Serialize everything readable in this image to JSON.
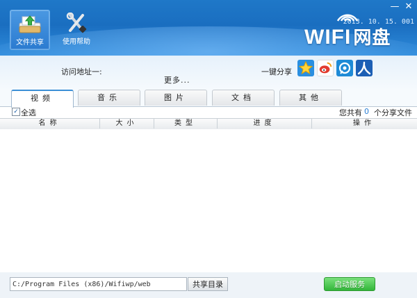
{
  "header": {
    "nav": [
      {
        "label": "文件共享",
        "icon": "folder-upload-icon",
        "active": true
      },
      {
        "label": "使用帮助",
        "icon": "tools-icon",
        "active": false
      }
    ],
    "version": "2013. 10. 15. 001",
    "brand_latin": "WIFI",
    "brand_cn": "网盘",
    "window_controls": [
      "—",
      "✕"
    ]
  },
  "info": {
    "access_label": "访问地址一:",
    "more_label": "更多...",
    "share_label": "一键分享",
    "share_icons": [
      {
        "name": "qzone-icon",
        "color": "#2a8fe0"
      },
      {
        "name": "weibo-icon",
        "color": "#e23b2e"
      },
      {
        "name": "tencent-weibo-icon",
        "color": "#1e8ad6"
      },
      {
        "name": "renren-icon",
        "color": "#1c5fb5"
      }
    ]
  },
  "tabs": [
    {
      "label": "视频",
      "active": true
    },
    {
      "label": "音乐",
      "active": false
    },
    {
      "label": "图片",
      "active": false
    },
    {
      "label": "文档",
      "active": false
    },
    {
      "label": "其他",
      "active": false
    }
  ],
  "toolbar": {
    "select_all": "全选",
    "count_prefix": "您共有",
    "count": "0",
    "count_suffix": "个分享文件"
  },
  "table": {
    "columns": [
      "名称",
      "大小",
      "类型",
      "进度",
      "操作"
    ]
  },
  "footer": {
    "path": "C:/Program Files (x86)/Wifiwp/web",
    "share_dir_label": "共享目录",
    "start_label": "启动服务"
  },
  "colors": {
    "header_blue": "#1f78c8",
    "accent": "#3c8fd6",
    "start_green": "#33b63a",
    "count_blue": "#2a7fd4"
  }
}
